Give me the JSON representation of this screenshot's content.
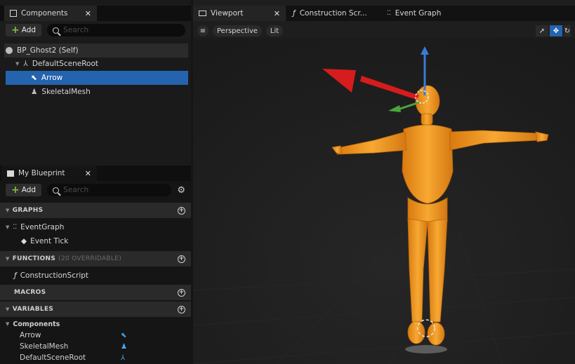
{
  "components_panel": {
    "tab_label": "Components",
    "add_label": "Add",
    "search_placeholder": "Search",
    "tree": [
      {
        "label": "BP_Ghost2 (Self)"
      },
      {
        "label": "DefaultSceneRoot"
      },
      {
        "label": "Arrow"
      },
      {
        "label": "SkeletalMesh"
      }
    ]
  },
  "blueprint_panel": {
    "tab_label": "My Blueprint",
    "add_label": "Add",
    "search_placeholder": "Search",
    "graphs_label": "GRAPHS",
    "event_graph": "EventGraph",
    "event_tick": "Event Tick",
    "functions_label": "FUNCTIONS",
    "functions_sub": "(20 OVERRIDABLE)",
    "construction_script": "ConstructionScript",
    "macros_label": "MACROS",
    "variables_label": "VARIABLES",
    "components_group": "Components",
    "variables": [
      "Arrow",
      "SkeletalMesh",
      "DefaultSceneRoot"
    ]
  },
  "viewport": {
    "tabs": [
      "Viewport",
      "Construction Scr...",
      "Event Graph"
    ],
    "perspective_label": "Perspective",
    "lit_label": "Lit"
  },
  "colors": {
    "selection": "#2463ad",
    "accent_blue": "#3fa9f5",
    "add_green": "#7cc242",
    "mannequin": "#f39a1d"
  }
}
